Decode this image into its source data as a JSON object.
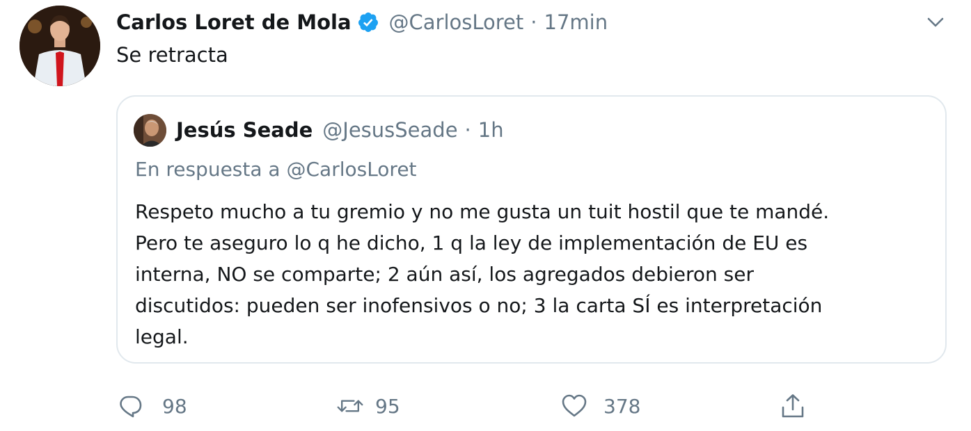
{
  "tweet": {
    "author": {
      "display_name": "Carlos Loret de Mola",
      "handle": "@CarlosLoret",
      "verified": true,
      "avatar_icon": "profile-photo"
    },
    "separator": "·",
    "time": "17min",
    "text": "Se retracta",
    "menu_icon": "chevron-down-icon"
  },
  "quoted_tweet": {
    "author": {
      "display_name": "Jesús Seade",
      "handle": "@JesusSeade",
      "avatar_icon": "profile-photo"
    },
    "separator": "·",
    "time": "1h",
    "reply_to": "En respuesta a @CarlosLoret",
    "body_lines": [
      "Respeto mucho a tu gremio y no me gusta un tuit hostil que te mandé.",
      "Pero te aseguro lo q he dicho, 1 q la ley de implementación de EU es",
      "interna, NO se comparte; 2 aún así, los agregados debieron ser",
      "discutidos: pueden ser inofensivos o no; 3 la carta SÍ es interpretación",
      "legal."
    ]
  },
  "actions": {
    "reply": {
      "icon": "reply-icon",
      "count": "98"
    },
    "retweet": {
      "icon": "retweet-icon",
      "count": "95"
    },
    "like": {
      "icon": "heart-icon",
      "count": "378"
    },
    "share": {
      "icon": "share-icon"
    }
  },
  "colors": {
    "text": "#14171a",
    "secondary": "#657786",
    "border": "#e1e8ed",
    "verified_blue": "#1da1f2"
  }
}
